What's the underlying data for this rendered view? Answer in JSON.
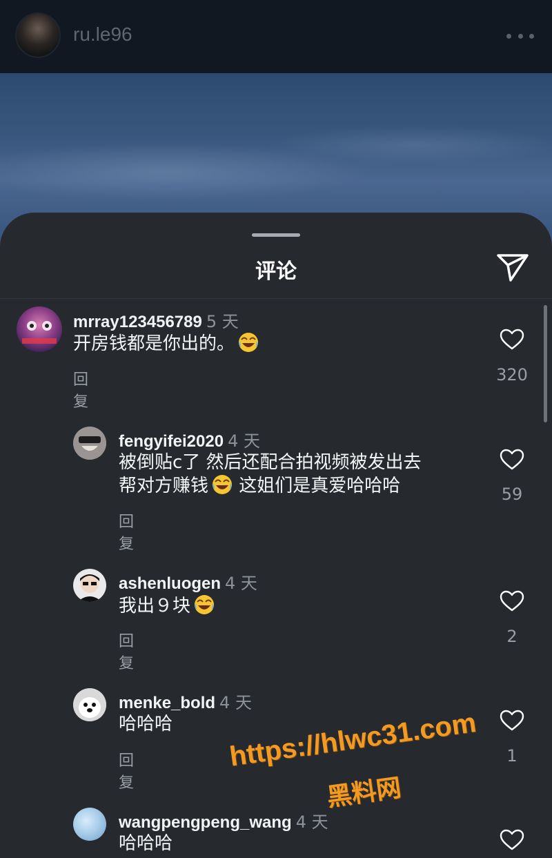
{
  "header": {
    "username": "ru.le96",
    "more_icon": "more-horizontal-icon"
  },
  "sheet": {
    "title": "评论",
    "send_icon": "send-icon"
  },
  "comments": [
    {
      "user": "mrray123456789",
      "time": "5 天",
      "text": "开房钱都是你出的。",
      "emoji_after": true,
      "reply": "回复",
      "likes": "320"
    },
    {
      "user": "fengyifei2020",
      "time": "4 天",
      "line1": "被倒贴c了  然后还配合拍视频被发出去",
      "line2a": "帮对方赚钱",
      "line2b": "  这姐们是真爱哈哈哈",
      "reply": "回复",
      "likes": "59"
    },
    {
      "user": "ashenluogen",
      "time": "4 天",
      "text": "我出９块",
      "reply": "回复",
      "likes": "2"
    },
    {
      "user": "menke_bold",
      "time": "4 天",
      "text": "哈哈哈",
      "reply": "回复",
      "likes": "1"
    },
    {
      "user": "wangpengpeng_wang",
      "time": "4 天",
      "text": "哈哈哈"
    }
  ],
  "watermark": {
    "url": "https://hlwc31.com",
    "name": "黑料网"
  },
  "colors": {
    "sheet_bg": "#26292e",
    "watermark": "#f39a23"
  }
}
